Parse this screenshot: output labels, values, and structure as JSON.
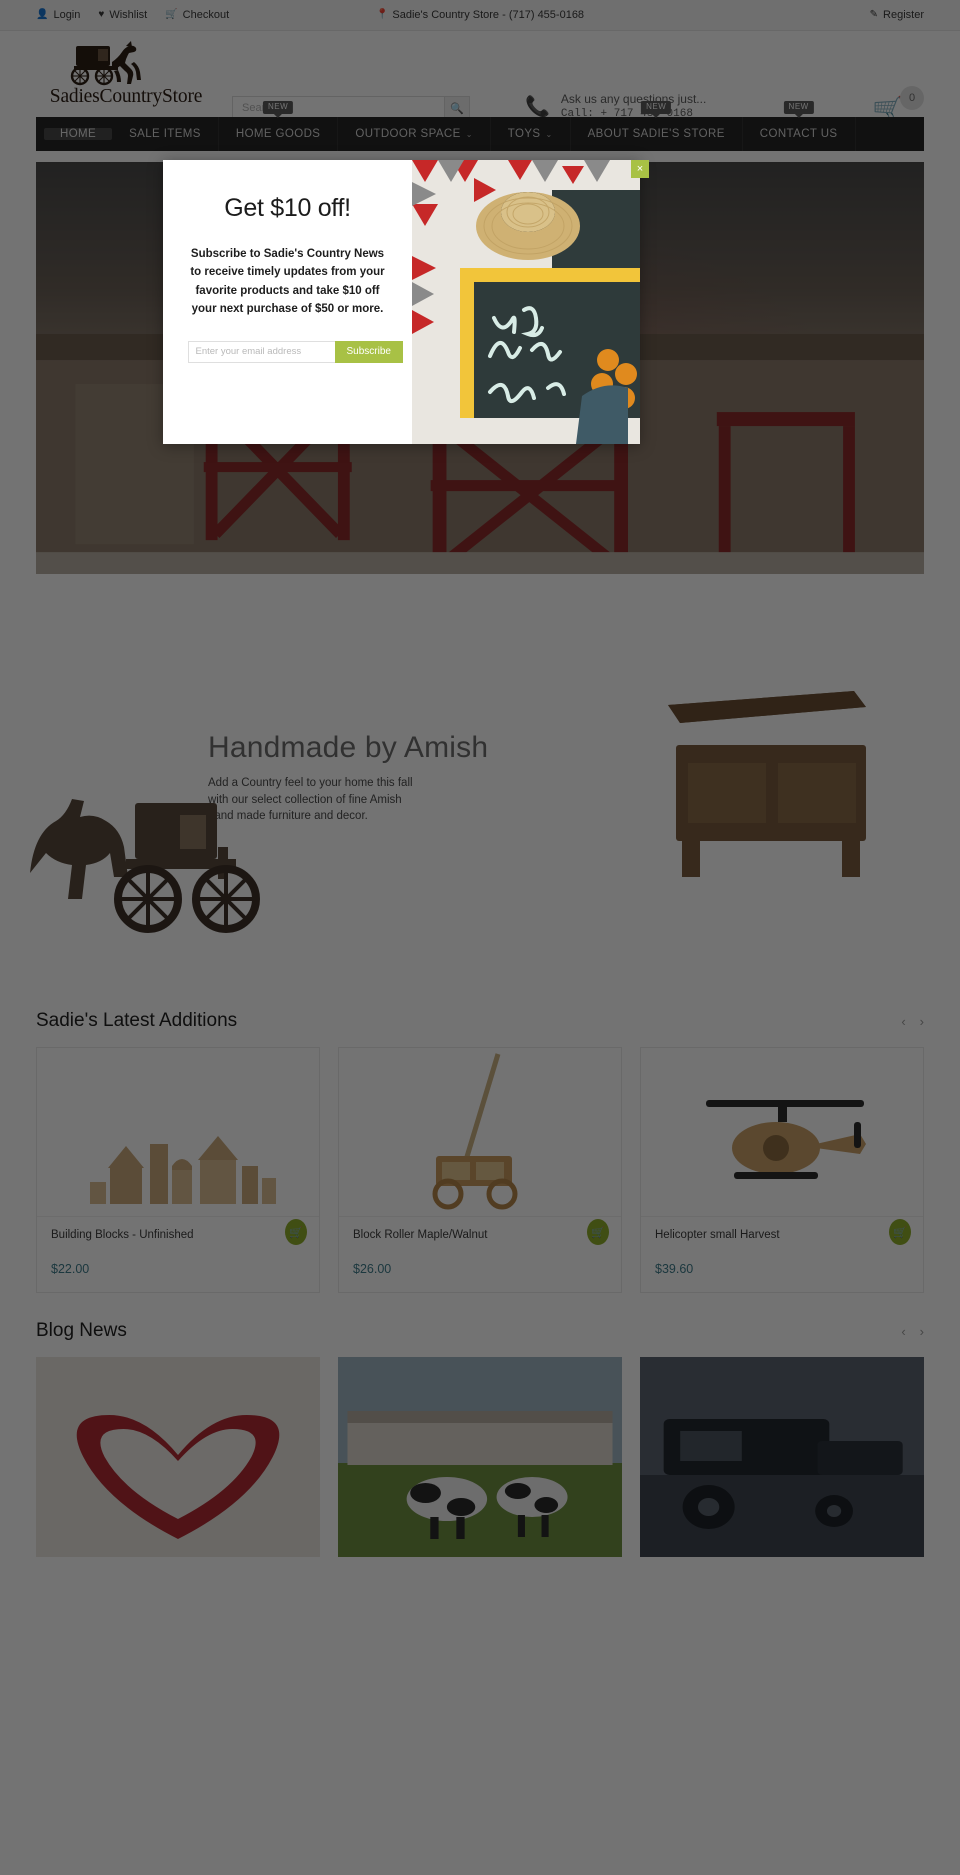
{
  "topbar": {
    "login": "Login",
    "wishlist": "Wishlist",
    "checkout": "Checkout",
    "store_info": "Sadie's Country Store - (717) 455-0168",
    "register": "Register"
  },
  "header": {
    "logo_text": "SadiesCountryStore",
    "search_placeholder": "Search",
    "search_value": "",
    "phone_question": "Ask us any questions just...",
    "phone_number": "Call: + 717 455 0168",
    "cart_count": "0"
  },
  "nav": {
    "items": [
      {
        "label": "HOME",
        "caret": "",
        "badge": "",
        "active": true
      },
      {
        "label": "SALE ITEMS",
        "caret": "",
        "badge": "",
        "active": false
      },
      {
        "label": "HOME GOODS",
        "caret": "",
        "badge": "NEW",
        "active": false
      },
      {
        "label": "OUTDOOR SPACE",
        "caret": "⌄",
        "badge": "",
        "active": false
      },
      {
        "label": "TOYS",
        "caret": "⌄",
        "badge": "",
        "active": false
      },
      {
        "label": "ABOUT SADIE'S STORE",
        "caret": "",
        "badge": "NEW",
        "active": false
      },
      {
        "label": "CONTACT US",
        "caret": "",
        "badge": "NEW",
        "active": false
      }
    ]
  },
  "hero": {
    "slide_count": 4,
    "active_slide": 1
  },
  "amish": {
    "title": "Handmade by Amish",
    "subtitle": "Add a Country feel to your home this fall\nwith our select collection of fine Amish\nhand made furniture and decor."
  },
  "latest": {
    "title": "Sadie's Latest Additions",
    "prev": "‹",
    "next": "›",
    "products": [
      {
        "name": "Building Blocks - Unfinished",
        "price": "$22.00",
        "cart_icon": "cart-icon"
      },
      {
        "name": "Block Roller Maple/Walnut",
        "price": "$26.00",
        "cart_icon": "cart-icon"
      },
      {
        "name": "Helicopter small Harvest",
        "price": "$39.60",
        "cart_icon": "cart-icon"
      }
    ]
  },
  "blog": {
    "title": "Blog News",
    "prev": "‹",
    "next": "›",
    "posts": [
      {
        "alt": "quilt-heart-photo"
      },
      {
        "alt": "cows-pasture-photo"
      },
      {
        "alt": "farm-equipment-photo"
      }
    ]
  },
  "modal": {
    "title": "Get $10 off!",
    "body": "Subscribe to Sadie's Country News to receive timely updates from your favorite products and take $10 off your next purchase of $50 or more.",
    "email_placeholder": "Enter your email address",
    "email_value": "",
    "subscribe_label": "Subscribe",
    "close_label": "×"
  },
  "colors": {
    "accent_green": "#a8c145",
    "nav_dark": "#262626",
    "price_blue": "#3f7d8c",
    "cart_green": "#8fae2b"
  },
  "icons": {
    "user": "user-icon",
    "heart": "heart-icon",
    "basket": "basket-icon",
    "pin": "map-pin-icon",
    "pencil": "pencil-icon",
    "search": "search-icon",
    "phone": "phone-icon",
    "cart": "shopping-cart-icon"
  }
}
